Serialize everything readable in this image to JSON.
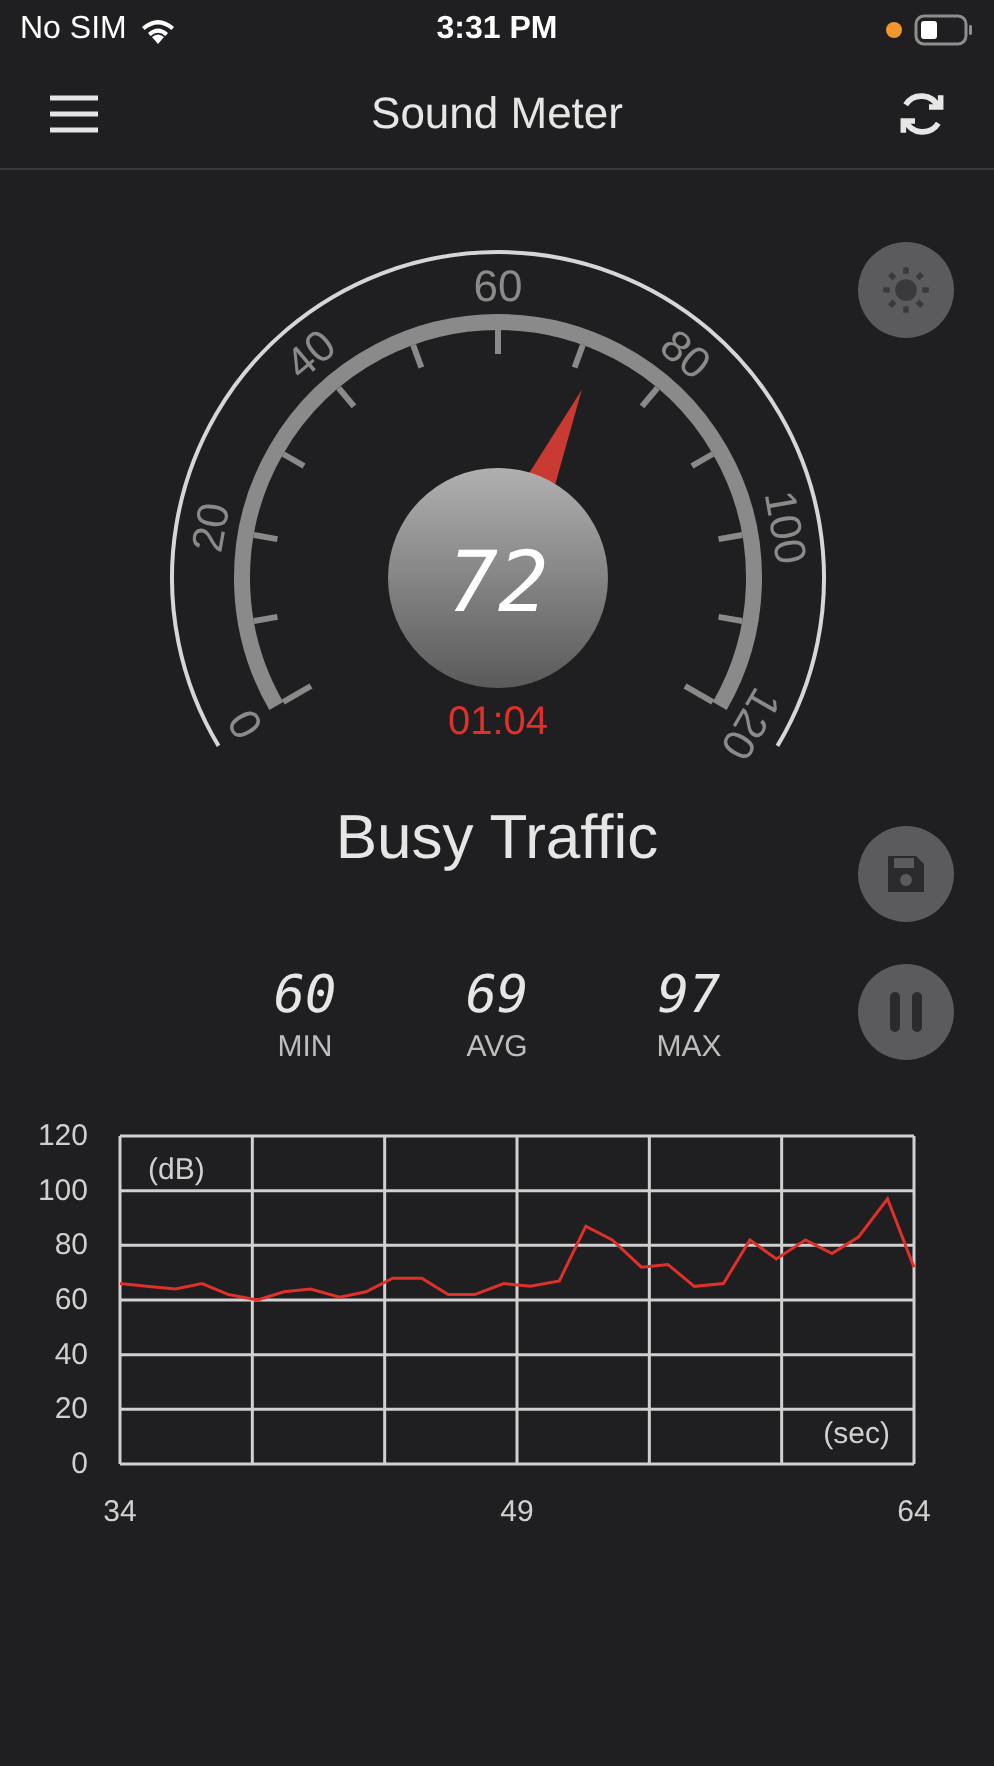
{
  "status_bar": {
    "carrier": "No SIM",
    "time": "3:31 PM"
  },
  "header": {
    "title": "Sound Meter"
  },
  "gauge": {
    "scale_labels": [
      "0",
      "20",
      "40",
      "60",
      "80",
      "100",
      "120"
    ],
    "reading": "72",
    "timer": "01:04"
  },
  "status": "Busy Traffic",
  "stats": [
    {
      "value": "60",
      "label": "MIN"
    },
    {
      "value": "69",
      "label": "AVG"
    },
    {
      "value": "97",
      "label": "MAX"
    }
  ],
  "chart": {
    "chart_data": {
      "type": "line",
      "xlabel": "(sec)",
      "ylabel": "(dB)",
      "x": [
        34.0,
        35.0,
        36.1,
        37.1,
        38.1,
        39.2,
        40.2,
        41.2,
        42.3,
        43.3,
        44.3,
        45.4,
        46.4,
        47.4,
        48.5,
        49.5,
        50.6,
        51.6,
        52.6,
        53.7,
        54.7,
        55.7,
        56.8,
        57.8,
        58.8,
        59.9,
        60.9,
        61.9,
        63.0,
        64.0
      ],
      "grid": true,
      "series": [
        {
          "color": "#e0302a",
          "values": [
            66,
            65,
            64,
            66,
            62,
            60,
            63,
            64,
            61,
            63,
            68,
            68,
            62,
            62,
            66,
            65,
            67,
            87,
            82,
            72,
            73,
            65,
            66,
            82,
            75,
            82,
            77,
            83,
            97,
            72
          ]
        }
      ],
      "xlim": [
        34,
        64
      ],
      "ylim": [
        0,
        120
      ],
      "xticks": [
        34,
        49,
        64
      ],
      "yticks": [
        0,
        20,
        40,
        60,
        80,
        100,
        120
      ]
    }
  }
}
